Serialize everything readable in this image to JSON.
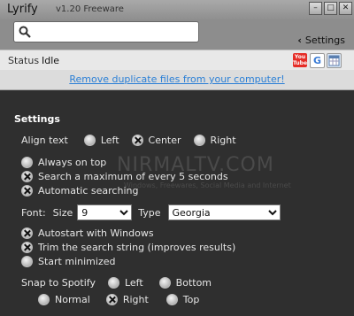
{
  "window": {
    "title": "Lyrify",
    "version": "v1.20 Freeware"
  },
  "toolbar": {
    "settings_label": "Settings",
    "search_placeholder": ""
  },
  "status": {
    "label": "Status",
    "value": "Idle"
  },
  "services": {
    "youtube_text": "You Tube",
    "google_text": "G"
  },
  "ad": {
    "link_text": "Remove duplicate files from your computer!"
  },
  "watermark": {
    "main": "NIRMALTV.COM",
    "sub": "Windows, Freewares, Social Media and Internet"
  },
  "settings": {
    "title": "Settings",
    "align": {
      "label": "Align text",
      "options": [
        "Left",
        "Center",
        "Right"
      ],
      "selected": "Center"
    },
    "always_on_top": {
      "label": "Always on top",
      "checked": false
    },
    "search_max": {
      "label": "Search a maximum of every 5 seconds",
      "checked": true
    },
    "auto_search": {
      "label": "Automatic searching",
      "checked": true
    },
    "font": {
      "label": "Font:",
      "size_label": "Size",
      "size_value": "9",
      "type_label": "Type",
      "type_value": "Georgia"
    },
    "autostart": {
      "label": "Autostart with Windows",
      "checked": true
    },
    "trim": {
      "label": "Trim the search string (improves results)",
      "checked": true
    },
    "start_min": {
      "label": "Start minimized",
      "checked": false
    },
    "snap": {
      "label": "Snap to Spotify",
      "row1": [
        "Left",
        "Bottom"
      ],
      "row2": [
        "Normal",
        "Right",
        "Top"
      ],
      "selected": "Right"
    }
  }
}
